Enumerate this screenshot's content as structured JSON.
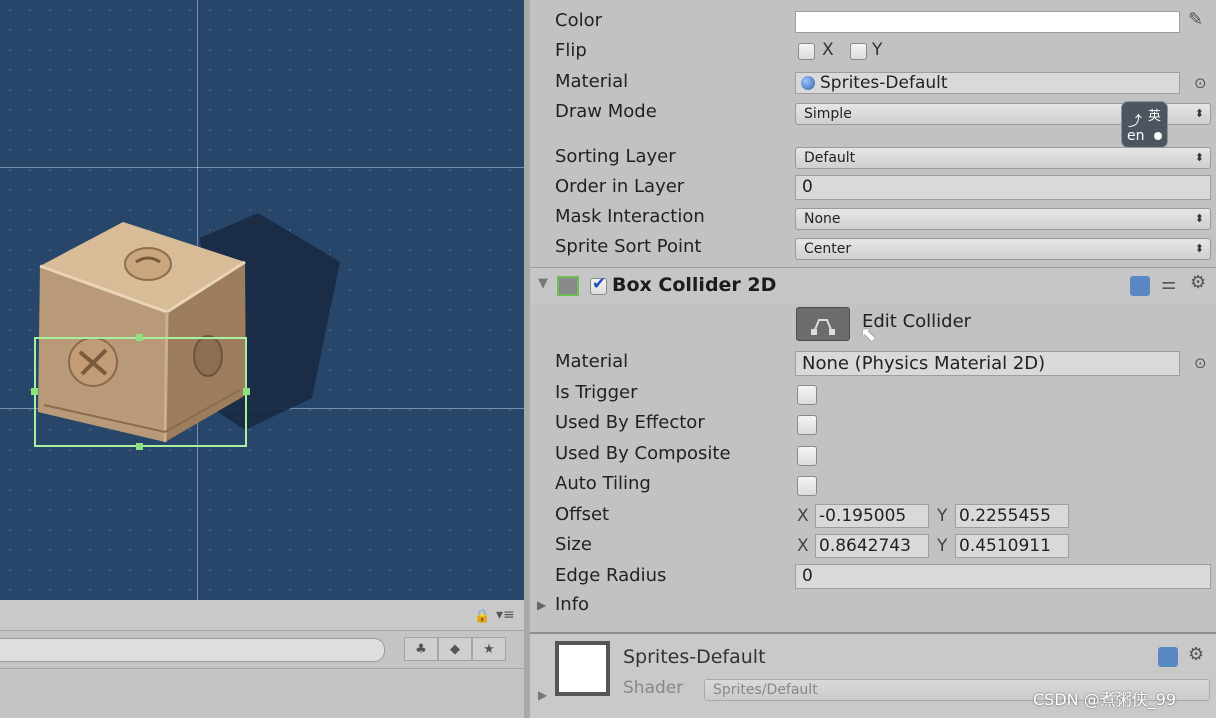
{
  "renderer": {
    "color_label": "Color",
    "flip_label": "Flip",
    "flip_x": "X",
    "flip_y": "Y",
    "material_label": "Material",
    "material_value": "Sprites-Default",
    "draw_mode_label": "Draw Mode",
    "draw_mode_value": "Simple",
    "sorting_layer_label": "Sorting Layer",
    "sorting_layer_value": "Default",
    "order_label": "Order in Layer",
    "order_value": "0",
    "mask_label": "Mask Interaction",
    "mask_value": "None",
    "sort_point_label": "Sprite Sort Point",
    "sort_point_value": "Center"
  },
  "collider": {
    "title": "Box Collider 2D",
    "enabled": true,
    "edit_label": "Edit Collider",
    "material_label": "Material",
    "material_value": "None (Physics Material 2D)",
    "is_trigger_label": "Is Trigger",
    "effector_label": "Used By Effector",
    "composite_label": "Used By Composite",
    "auto_tiling_label": "Auto Tiling",
    "offset_label": "Offset",
    "offset_x_label": "X",
    "offset_x": "-0.195005",
    "offset_y_label": "Y",
    "offset_y": "0.2255455",
    "size_label": "Size",
    "size_x_label": "X",
    "size_x": "0.8642743",
    "size_y_label": "Y",
    "size_y": "0.4510911",
    "edge_radius_label": "Edge Radius",
    "edge_radius_value": "0",
    "info_label": "Info"
  },
  "material_footer": {
    "name": "Sprites-Default",
    "shader_label": "Shader",
    "shader_value": "Sprites/Default"
  },
  "ime_badge": {
    "top_text": "英",
    "bottom_text": "en"
  },
  "watermark": "CSDN @煮粥侠_99",
  "colors": {
    "scene_bg": "#27466a",
    "collider_outline": "#a8f0a0",
    "inspector_bg": "#c2c2c2"
  }
}
